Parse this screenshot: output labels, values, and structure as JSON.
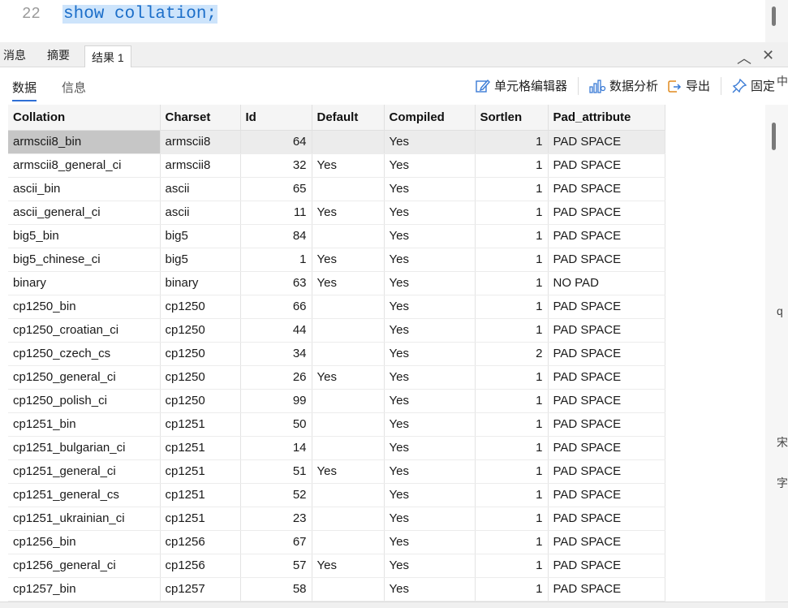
{
  "editor": {
    "line_number": "22",
    "code": "show collation;"
  },
  "result_tabs": [
    {
      "label": "消息"
    },
    {
      "label": "摘要"
    },
    {
      "label": "结果 1"
    }
  ],
  "window_controls": {
    "collapse": "︿",
    "close": "✕"
  },
  "sub_tabs": [
    {
      "label": "数据"
    },
    {
      "label": "信息"
    }
  ],
  "toolbar": {
    "cell_editor": "单元格编辑器",
    "data_analysis": "数据分析",
    "export": "导出",
    "pin": "固定"
  },
  "table": {
    "columns": [
      "Collation",
      "Charset",
      "Id",
      "Default",
      "Compiled",
      "Sortlen",
      "Pad_attribute"
    ],
    "rows": [
      [
        "armscii8_bin",
        "armscii8",
        "64",
        "",
        "Yes",
        "1",
        "PAD SPACE"
      ],
      [
        "armscii8_general_ci",
        "armscii8",
        "32",
        "Yes",
        "Yes",
        "1",
        "PAD SPACE"
      ],
      [
        "ascii_bin",
        "ascii",
        "65",
        "",
        "Yes",
        "1",
        "PAD SPACE"
      ],
      [
        "ascii_general_ci",
        "ascii",
        "11",
        "Yes",
        "Yes",
        "1",
        "PAD SPACE"
      ],
      [
        "big5_bin",
        "big5",
        "84",
        "",
        "Yes",
        "1",
        "PAD SPACE"
      ],
      [
        "big5_chinese_ci",
        "big5",
        "1",
        "Yes",
        "Yes",
        "1",
        "PAD SPACE"
      ],
      [
        "binary",
        "binary",
        "63",
        "Yes",
        "Yes",
        "1",
        "NO PAD"
      ],
      [
        "cp1250_bin",
        "cp1250",
        "66",
        "",
        "Yes",
        "1",
        "PAD SPACE"
      ],
      [
        "cp1250_croatian_ci",
        "cp1250",
        "44",
        "",
        "Yes",
        "1",
        "PAD SPACE"
      ],
      [
        "cp1250_czech_cs",
        "cp1250",
        "34",
        "",
        "Yes",
        "2",
        "PAD SPACE"
      ],
      [
        "cp1250_general_ci",
        "cp1250",
        "26",
        "Yes",
        "Yes",
        "1",
        "PAD SPACE"
      ],
      [
        "cp1250_polish_ci",
        "cp1250",
        "99",
        "",
        "Yes",
        "1",
        "PAD SPACE"
      ],
      [
        "cp1251_bin",
        "cp1251",
        "50",
        "",
        "Yes",
        "1",
        "PAD SPACE"
      ],
      [
        "cp1251_bulgarian_ci",
        "cp1251",
        "14",
        "",
        "Yes",
        "1",
        "PAD SPACE"
      ],
      [
        "cp1251_general_ci",
        "cp1251",
        "51",
        "Yes",
        "Yes",
        "1",
        "PAD SPACE"
      ],
      [
        "cp1251_general_cs",
        "cp1251",
        "52",
        "",
        "Yes",
        "1",
        "PAD SPACE"
      ],
      [
        "cp1251_ukrainian_ci",
        "cp1251",
        "23",
        "",
        "Yes",
        "1",
        "PAD SPACE"
      ],
      [
        "cp1256_bin",
        "cp1256",
        "67",
        "",
        "Yes",
        "1",
        "PAD SPACE"
      ],
      [
        "cp1256_general_ci",
        "cp1256",
        "57",
        "Yes",
        "Yes",
        "1",
        "PAD SPACE"
      ],
      [
        "cp1257_bin",
        "cp1257",
        "58",
        "",
        "Yes",
        "1",
        "PAD SPACE"
      ]
    ]
  },
  "side_fragments": [
    "中",
    "q",
    "宋",
    "字"
  ],
  "colors": {
    "accent": "#2f6fd6",
    "code_text": "#1b6ec9",
    "code_highlight": "#cde4fb",
    "selected_cell": "#c6c6c6"
  }
}
